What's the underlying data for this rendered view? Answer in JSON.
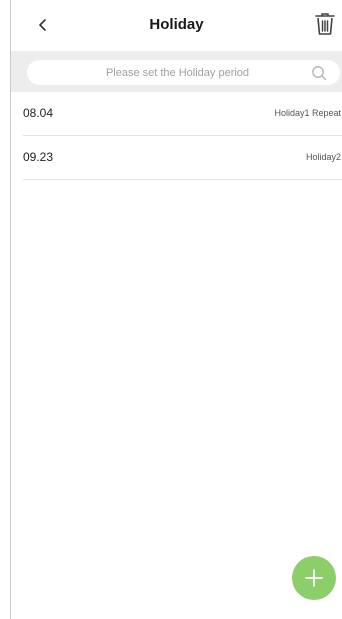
{
  "header": {
    "title": "Holiday",
    "back_icon": "chevron-left-icon",
    "delete_icon": "trash-icon"
  },
  "search": {
    "placeholder": "Please set the Holiday period",
    "icon": "search-icon"
  },
  "holidays": [
    {
      "date": "08.04",
      "description": "Holiday1 Repeat"
    },
    {
      "date": "09.23",
      "description": "Holiday2"
    }
  ],
  "fab": {
    "icon": "plus-icon",
    "color": "#8ccf6a"
  },
  "colors": {
    "search_strip": "#ededed",
    "divider": "#e4e4e4"
  }
}
